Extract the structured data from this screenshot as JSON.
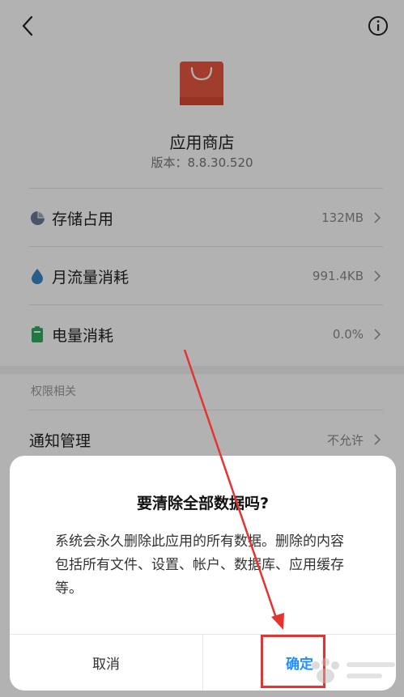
{
  "app": {
    "name": "应用商店",
    "version": "版本：8.8.30.520",
    "icon_color": "#e8573f"
  },
  "rows": [
    {
      "label": "存储占用",
      "value": "132MB",
      "icon": "pie-chart-icon"
    },
    {
      "label": "月流量消耗",
      "value": "991.4KB",
      "icon": "water-drop-icon"
    },
    {
      "label": "电量消耗",
      "value": "0.0%",
      "icon": "battery-icon"
    }
  ],
  "section": {
    "permissions_label": "权限相关",
    "notify_label": "通知管理",
    "notify_value": "不允许"
  },
  "dialog": {
    "title": "要清除全部数据吗?",
    "message": "系统会永久删除此应用的所有数据。删除的内容包括所有文件、设置、帐户、数据库、应用缓存等。",
    "cancel": "取消",
    "confirm": "确定"
  },
  "colors": {
    "accent": "#1e8fff",
    "annotation": "#e5342f",
    "storage_icon": "#6b7b94",
    "traffic_icon": "#3a86c8",
    "battery_icon": "#2fae5f"
  }
}
